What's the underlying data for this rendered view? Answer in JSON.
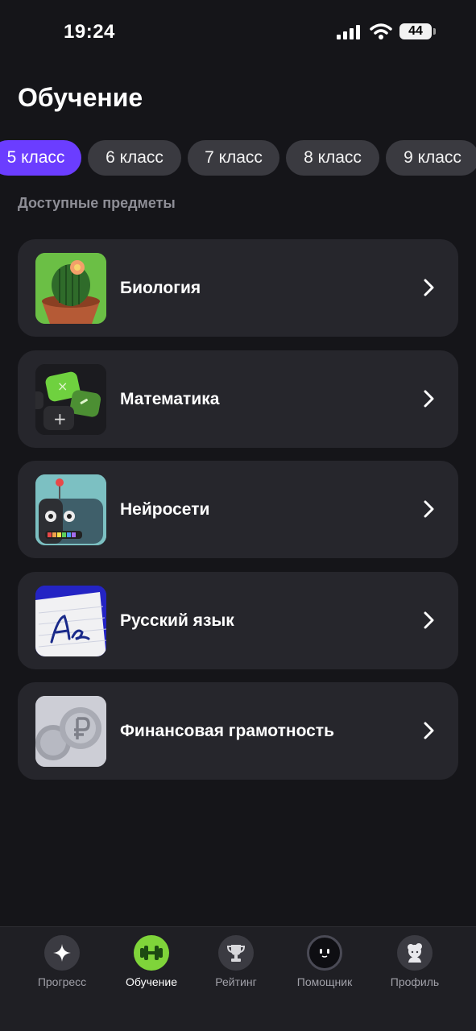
{
  "status_bar": {
    "time": "19:24",
    "battery": "44"
  },
  "page": {
    "title": "Обучение",
    "section_label": "Доступные предметы"
  },
  "grades": [
    {
      "label": "5 класс",
      "active": true
    },
    {
      "label": "6 класс",
      "active": false
    },
    {
      "label": "7 класс",
      "active": false
    },
    {
      "label": "8 класс",
      "active": false
    },
    {
      "label": "9 класс",
      "active": false
    }
  ],
  "subjects": [
    {
      "title": "Биология",
      "icon": "cactus-icon"
    },
    {
      "title": "Математика",
      "icon": "math-keys-icon"
    },
    {
      "title": "Нейросети",
      "icon": "robot-icon"
    },
    {
      "title": "Русский язык",
      "icon": "notebook-icon"
    },
    {
      "title": "Финансовая грамотность",
      "icon": "coins-icon"
    }
  ],
  "tab_bar": {
    "items": [
      {
        "label": "Прогресс",
        "icon": "sparkle-icon",
        "active": false
      },
      {
        "label": "Обучение",
        "icon": "dumbbell-icon",
        "active": true
      },
      {
        "label": "Рейтинг",
        "icon": "trophy-icon",
        "active": false
      },
      {
        "label": "Помощник",
        "icon": "assistant-icon",
        "active": false
      },
      {
        "label": "Профиль",
        "icon": "profile-icon",
        "active": false
      }
    ]
  },
  "colors": {
    "background": "#151519",
    "card": "#26262c",
    "chip": "#3a3a40",
    "accent": "#6b3dff",
    "tab_active": "#7fd43a"
  }
}
